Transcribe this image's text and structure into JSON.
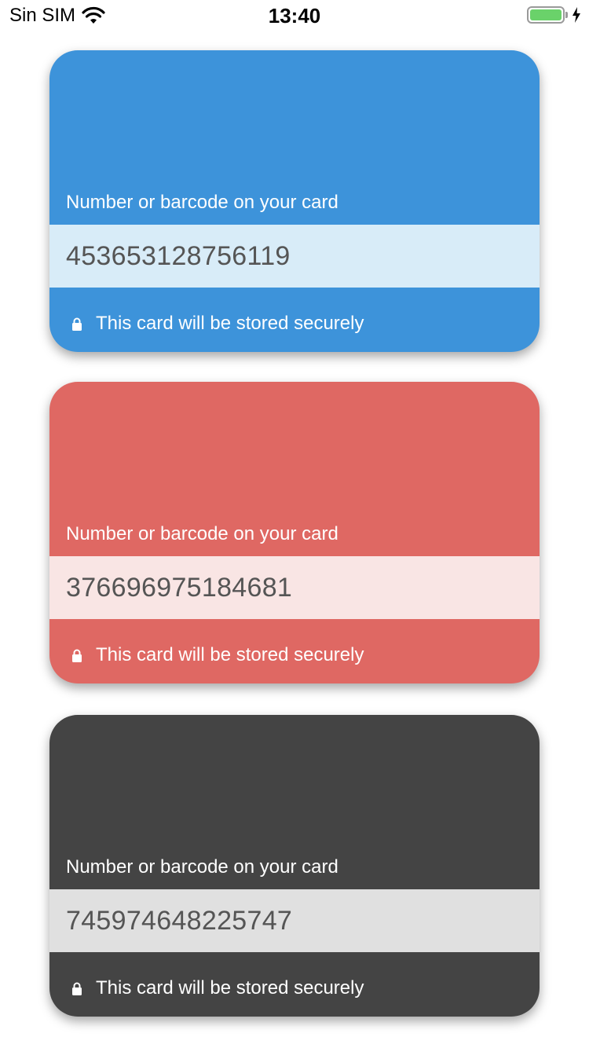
{
  "status_bar": {
    "carrier": "Sin SIM",
    "time": "13:40",
    "icons": [
      "wifi-icon",
      "battery-icon",
      "charging-bolt-icon"
    ]
  },
  "cards": [
    {
      "label": "Number or barcode on your card",
      "number": "453653128756119",
      "footer": "This card will be stored securely",
      "color": "#3d93da",
      "band_color": "#d8ecf8"
    },
    {
      "label": "Number or barcode on your card",
      "number": "376696975184681",
      "footer": "This card will be stored securely",
      "color": "#df6863",
      "band_color": "#f9e5e4"
    },
    {
      "label": "Number or barcode on your card",
      "number": "745974648225747",
      "footer": "This card will be stored securely",
      "color": "#444444",
      "band_color": "#e0e0e0"
    }
  ]
}
